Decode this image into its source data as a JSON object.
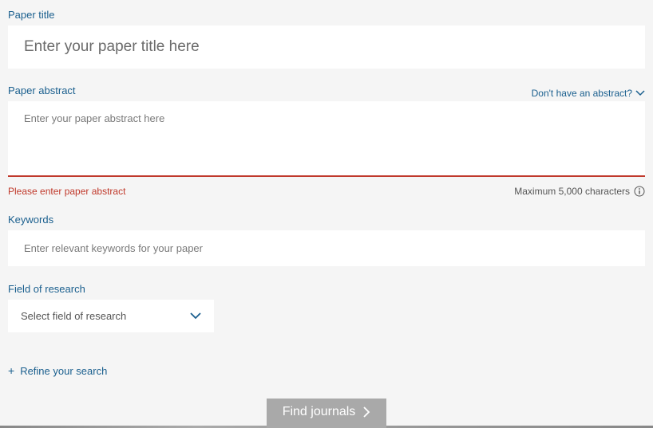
{
  "title": {
    "label": "Paper title",
    "placeholder": "Enter your paper title here"
  },
  "abstract": {
    "label": "Paper abstract",
    "help_link": "Don't have an abstract?",
    "placeholder": "Enter your paper abstract here",
    "error": "Please enter paper abstract",
    "max_chars": "Maximum 5,000 characters"
  },
  "keywords": {
    "label": "Keywords",
    "placeholder": "Enter relevant keywords for your paper"
  },
  "research_field": {
    "label": "Field of research",
    "placeholder": "Select field of research"
  },
  "refine": {
    "label": "Refine your search"
  },
  "submit": {
    "label": "Find journals"
  }
}
